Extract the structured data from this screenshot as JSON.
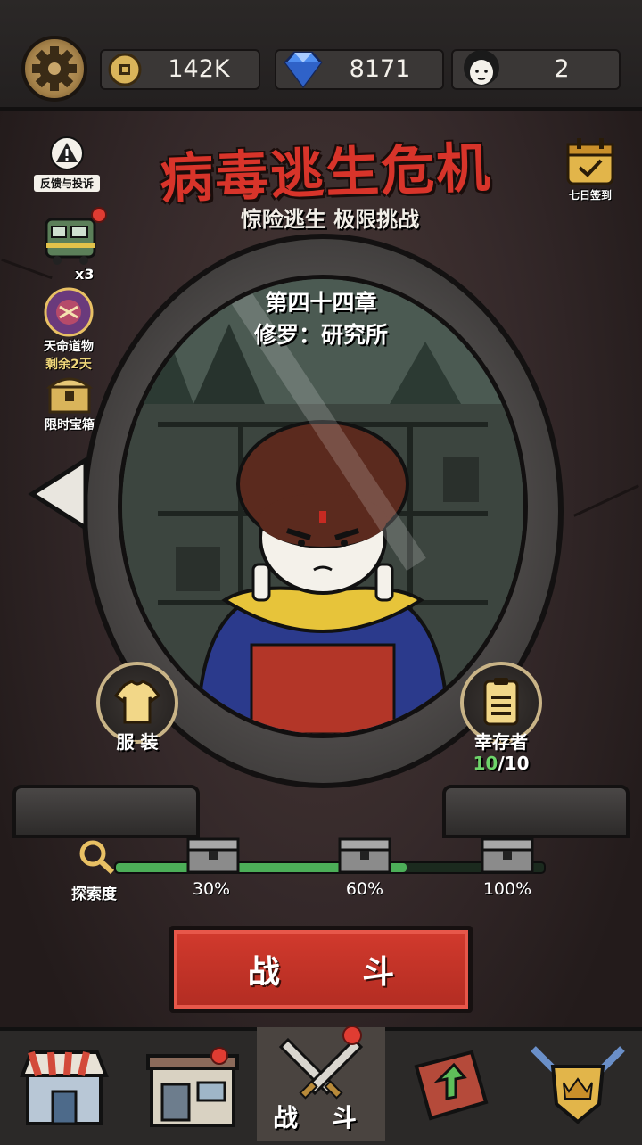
{
  "header": {
    "coins": "142K",
    "gems": "8171",
    "survivors_count": "2"
  },
  "title": {
    "main": "病毒逃生危机",
    "subtitle": "惊险逃生 极限挑战"
  },
  "side_left": {
    "feedback_label": "反馈与投诉",
    "train_badge": "x3",
    "destiny_label": "天命道物",
    "destiny_remaining": "剩余2天",
    "chest_label": "限时宝箱"
  },
  "side_right": {
    "signin_label": "七日签到"
  },
  "chapter": {
    "number": "第四十四章",
    "name": "修罗：研究所"
  },
  "buttons": {
    "costume_label": "服 装",
    "survivors_label": "幸存者",
    "survivors_current": "10",
    "survivors_total": "/10",
    "fight_label": "战 斗"
  },
  "progress": {
    "label": "探索度",
    "value_percent": 68,
    "milestones": [
      "30%",
      "60%",
      "100%"
    ]
  },
  "nav": {
    "active_label": "战 斗",
    "items": [
      "shop",
      "base",
      "battle",
      "upgrade",
      "guild"
    ]
  },
  "colors": {
    "title_red": "#d8342a",
    "progress_green": "#4cae58",
    "survivor_count_green": "#6ed46a",
    "accent_gold": "#c9a66a"
  }
}
